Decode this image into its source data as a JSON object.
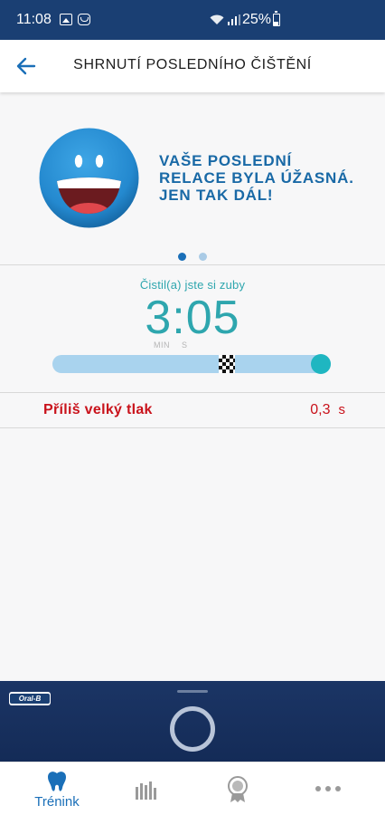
{
  "status_bar": {
    "time": "11:08",
    "battery": "25%"
  },
  "header": {
    "title": "SHRNUTÍ POSLEDNÍHO ČIŠTĚNÍ"
  },
  "hero": {
    "message": "VAŠE POSLEDNÍ\nRELACE BYLA ÚŽASNÁ.\nJEN TAK DÁL!"
  },
  "pager": {
    "page_count": 2,
    "active_index": 0
  },
  "duration": {
    "label": "Čistil(a) jste si zuby",
    "value": "3:05",
    "unit_min": "MIN",
    "unit_sec": "S",
    "progress_fraction": 0.75
  },
  "pressure": {
    "label": "Příliš velký tlak",
    "value": "0,3",
    "unit": "s"
  },
  "brand_panel": {
    "logo": "Oral-B"
  },
  "bottom_nav": {
    "items": [
      {
        "label": "Trénink",
        "icon": "tooth-icon",
        "active": true
      },
      {
        "label": "",
        "icon": "bar-chart-icon",
        "active": false
      },
      {
        "label": "",
        "icon": "award-medal-icon",
        "active": false
      },
      {
        "label": "",
        "icon": "more-dots-icon",
        "active": false
      }
    ]
  },
  "colors": {
    "status_bar": "#1a3f73",
    "accent_blue": "#1969a6",
    "teal": "#2ea6ae",
    "progress_track": "#a9d3ee",
    "progress_knob": "#1fb6c1",
    "warning_red": "#c9121b",
    "brand_panel": "#1b3565"
  }
}
